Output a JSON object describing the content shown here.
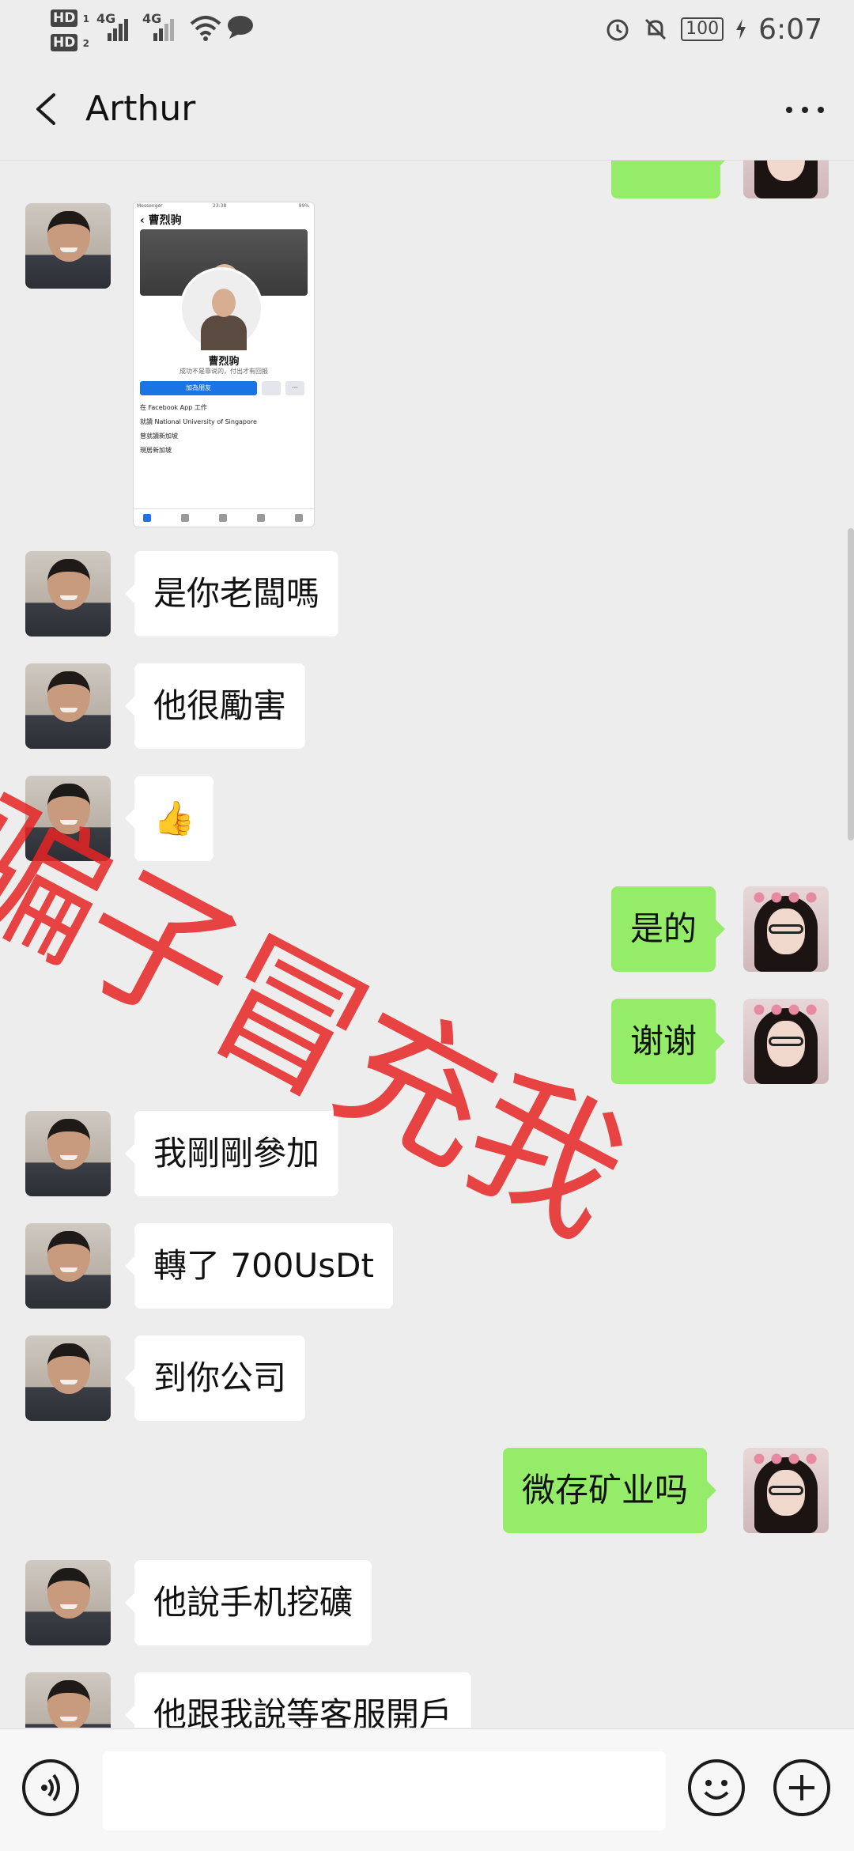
{
  "status_bar": {
    "hd1": "HD",
    "hd1_sub": "1",
    "hd2": "HD",
    "hd2_sub": "2",
    "network1": "4G",
    "network2": "4G",
    "battery": "100",
    "time": "6:07"
  },
  "header": {
    "title": "Arthur"
  },
  "shared_image": {
    "status_left": "Messenger",
    "status_time": "23:38",
    "status_right": "99%",
    "profile_title": "曹烈驹",
    "profile_name": "曹烈驹",
    "profile_subtitle": "成功不是靠说的，付出才有回报",
    "add_friend_button": "加為朋友",
    "more_dots": "···",
    "info_lines": [
      "在 Facebook App 工作",
      "就讀 National University of Singapore",
      "曾就讀新加坡",
      "現居新加坡"
    ]
  },
  "messages": [
    {
      "side": "left",
      "text": "是你老闆嗎"
    },
    {
      "side": "left",
      "text": "他很勵害"
    },
    {
      "side": "left",
      "text": "👍"
    },
    {
      "side": "right",
      "text": "是的"
    },
    {
      "side": "right",
      "text": "谢谢"
    },
    {
      "side": "left",
      "text": "我剛剛參加"
    },
    {
      "side": "left",
      "text": "轉了 700UsDt"
    },
    {
      "side": "left",
      "text": "到你公司"
    },
    {
      "side": "right",
      "text": "微存矿业吗"
    },
    {
      "side": "left",
      "text": "他說手机挖礦"
    },
    {
      "side": "left",
      "text": "他跟我說等客服開戶"
    }
  ],
  "watermark": "骗子冒充我",
  "colors": {
    "background": "#ededed",
    "bubble_right": "#95ec69",
    "bubble_left": "#ffffff",
    "watermark": "#e62424"
  },
  "icons": [
    "back-arrow-icon",
    "more-dots-icon",
    "voice-icon",
    "emoji-icon",
    "plus-icon",
    "alarm-icon",
    "mute-icon",
    "wifi-icon",
    "chat-bubble-icon",
    "charging-icon"
  ]
}
